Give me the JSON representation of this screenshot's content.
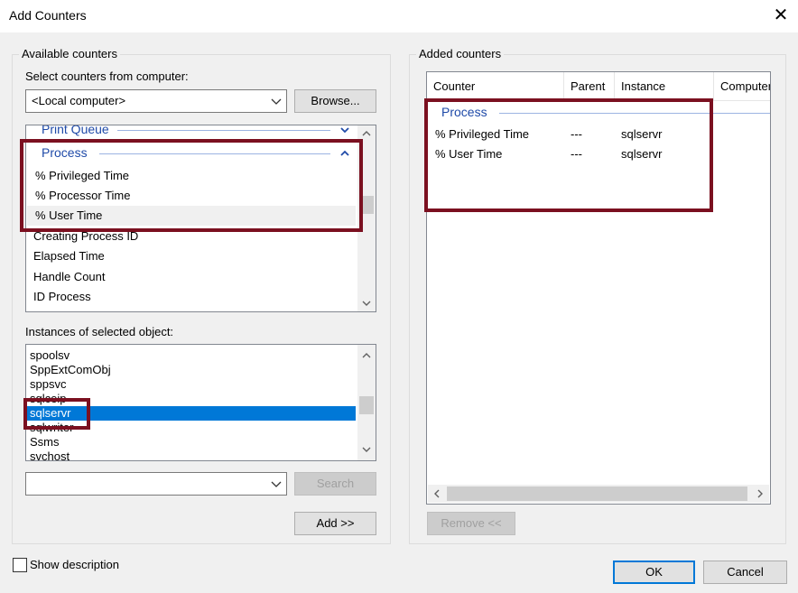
{
  "window": {
    "title": "Add Counters"
  },
  "available": {
    "group_title": "Available counters",
    "select_label": "Select counters from computer:",
    "computer_value": "<Local computer>",
    "browse_label": "Browse...",
    "objects": {
      "print_queue": "Print Queue",
      "process": "Process"
    },
    "counters": [
      "% Privileged Time",
      "% Processor Time",
      "% User Time",
      "Creating Process ID",
      "Elapsed Time",
      "Handle Count",
      "ID Process"
    ],
    "instances_label": "Instances of selected object:",
    "instances": [
      "spoolsv",
      "SppExtComObj",
      "sppsvc",
      "sqlceip",
      "sqlservr",
      "sqlwriter",
      "Ssms",
      "svchost"
    ],
    "selected_instance": "sqlservr",
    "search_value": "",
    "search_label": "Search",
    "add_label": "Add >>"
  },
  "added": {
    "group_title": "Added counters",
    "columns": [
      "Counter",
      "Parent",
      "Instance",
      "Computer"
    ],
    "object": "Process",
    "rows": [
      {
        "counter": "% Privileged Time",
        "parent": "---",
        "instance": "sqlservr"
      },
      {
        "counter": "% User Time",
        "parent": "---",
        "instance": "sqlservr"
      }
    ],
    "remove_label": "Remove <<"
  },
  "footer": {
    "show_description": "Show description",
    "ok_label": "OK",
    "cancel_label": "Cancel"
  },
  "colors": {
    "accent": "#0078d7",
    "highlight_box": "#7b1020",
    "object_header": "#1f4aa8"
  }
}
